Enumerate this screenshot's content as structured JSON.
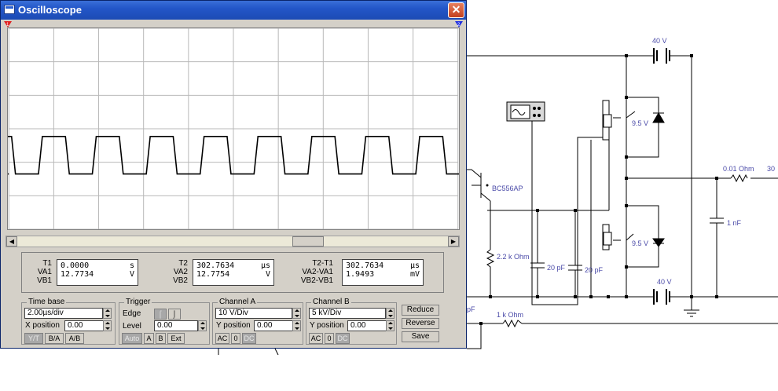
{
  "window": {
    "title": "Oscilloscope",
    "close_label": "✕"
  },
  "markers": {
    "t1": "1",
    "t2": "2"
  },
  "waveform": {
    "period_div": 1.2,
    "duty": 0.5,
    "high_div": 3.0,
    "low_div": 2.0
  },
  "readout": {
    "g1": {
      "labels": [
        "T1",
        "VA1",
        "VB1"
      ],
      "rows": [
        [
          "0.0000",
          "s"
        ],
        [
          "12.7734",
          "V"
        ],
        [
          "",
          ""
        ]
      ]
    },
    "g2": {
      "labels": [
        "T2",
        "VA2",
        "VB2"
      ],
      "rows": [
        [
          "302.7634",
          "µs"
        ],
        [
          "12.7754",
          "V"
        ],
        [
          "",
          ""
        ]
      ]
    },
    "g3": {
      "labels": [
        "T2-T1",
        "VA2-VA1",
        "VB2-VB1"
      ],
      "rows": [
        [
          "302.7634",
          "µs"
        ],
        [
          "1.9493",
          "mV"
        ],
        [
          "",
          ""
        ]
      ]
    }
  },
  "timebase": {
    "title": "Time base",
    "scale": "2.00µs/div",
    "xpos_label": "X position",
    "xpos": "0.00",
    "buttons": [
      "Y/T",
      "B/A",
      "A/B"
    ]
  },
  "trigger": {
    "title": "Trigger",
    "edge_label": "Edge",
    "level_label": "Level",
    "level": "0.00",
    "buttons": [
      "Auto",
      "A",
      "B",
      "Ext"
    ]
  },
  "channel_a": {
    "title": "Channel A",
    "scale": "10 V/Div",
    "ypos_label": "Y position",
    "ypos": "0.00",
    "buttons": [
      "AC",
      "0",
      "DC"
    ]
  },
  "channel_b": {
    "title": "Channel B",
    "scale": "5 kV/Div",
    "ypos_label": "Y position",
    "ypos": "0.00",
    "buttons": [
      "AC",
      "0",
      "DC"
    ]
  },
  "actions": {
    "reduce": "Reduce",
    "reverse": "Reverse",
    "save": "Save"
  },
  "schematic": {
    "labels": {
      "v40_top": "40 V",
      "v95_top": "9.5 V",
      "transistor": "BC556AP",
      "r001": "0.01  Ohm",
      "r30": "30",
      "c1nf": "1 nF",
      "v95_bot": "9.5 V",
      "r22k": "2.2 k Ohm",
      "c20a": "20 pF",
      "c20b": "20 pF",
      "v40_bot": "40 V",
      "r1k": "1 k Ohm",
      "pf": "pF"
    }
  }
}
